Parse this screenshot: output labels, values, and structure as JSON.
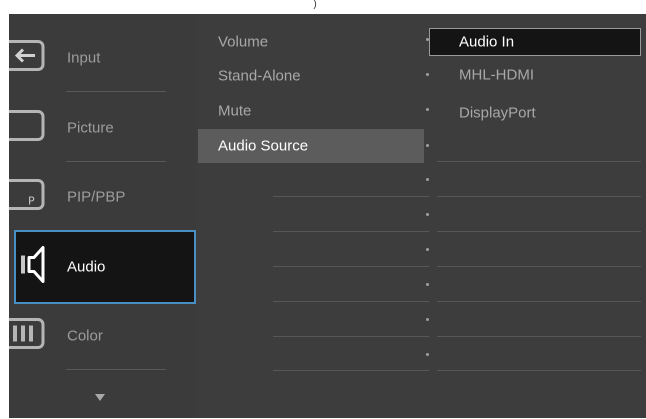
{
  "menu": {
    "categories": [
      {
        "label": "Input",
        "icon": "input-icon"
      },
      {
        "label": "Picture",
        "icon": "picture-icon"
      },
      {
        "label": "PIP/PBP",
        "icon": "pip-pbp-icon",
        "icon_glyph": "P"
      },
      {
        "label": "Audio",
        "icon": "audio-icon"
      },
      {
        "label": "Color",
        "icon": "color-icon"
      }
    ],
    "selected_category": "Audio",
    "more_indicator": "chevron-down-icon"
  },
  "audio_settings": {
    "items": [
      {
        "label": "Volume"
      },
      {
        "label": "Stand-Alone"
      },
      {
        "label": "Mute"
      },
      {
        "label": "Audio Source"
      }
    ],
    "active": "Audio Source"
  },
  "audio_source_options": {
    "items": [
      {
        "label": "Audio In"
      },
      {
        "label": "MHL-HDMI"
      },
      {
        "label": "DisplayPort"
      }
    ],
    "selected": "Audio In"
  },
  "colors": {
    "panel_bg": "#3e3e3e",
    "selected_bg": "#141414",
    "selected_border": "#4a8fc4",
    "active_row_bg": "#5c5c5c",
    "text_dim": "#a8a8a8",
    "text_bright": "#ffffff"
  }
}
